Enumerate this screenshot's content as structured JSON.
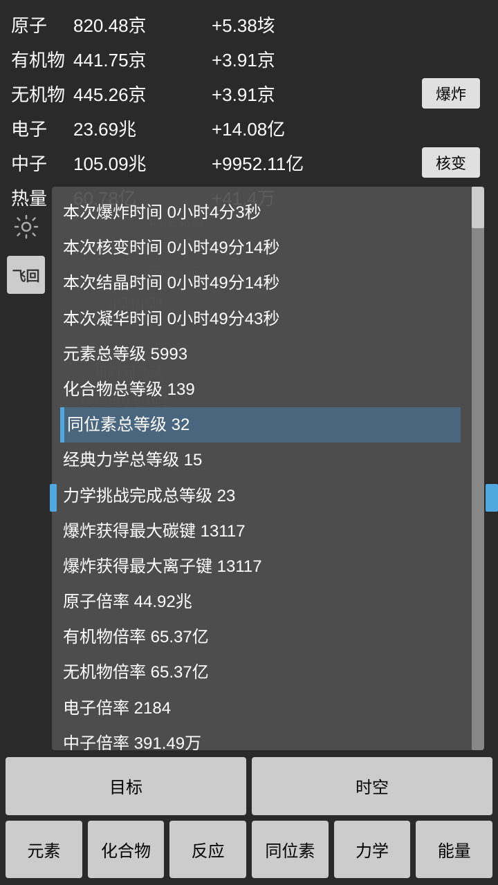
{
  "stats": [
    {
      "name": "原子",
      "value": "820.48京",
      "delta": "+5.38垓",
      "button": null
    },
    {
      "name": "有机物",
      "value": "441.75京",
      "delta": "+3.91京",
      "button": null
    },
    {
      "name": "无机物",
      "value": "445.26京",
      "delta": "+3.91京",
      "button": "爆炸"
    },
    {
      "name": "电子",
      "value": "23.69兆",
      "delta": "+14.08亿",
      "button": null
    },
    {
      "name": "中子",
      "value": "105.09兆",
      "delta": "+9952.11亿",
      "button": "核变"
    },
    {
      "name": "热量",
      "value": "60.78亿",
      "delta": "+41.4万",
      "button": null
    }
  ],
  "overlay_items": [
    {
      "text": "本次爆炸时间 0小时4分3秒",
      "highlighted": false
    },
    {
      "text": "本次核变时间 0小时49分14秒",
      "highlighted": false
    },
    {
      "text": "本次结晶时间 0小时49分14秒",
      "highlighted": false
    },
    {
      "text": "本次凝华时间 0小时49分43秒",
      "highlighted": false
    },
    {
      "text": "元素总等级 5993",
      "highlighted": false
    },
    {
      "text": "化合物总等级 139",
      "highlighted": false
    },
    {
      "text": "同位素总等级 32",
      "highlighted": true
    },
    {
      "text": "经典力学总等级 15",
      "highlighted": false
    },
    {
      "text": "力学挑战完成总等级 23",
      "highlighted": false
    },
    {
      "text": "爆炸获得最大碳键 13117",
      "highlighted": false
    },
    {
      "text": "爆炸获得最大离子键 13117",
      "highlighted": false
    },
    {
      "text": "原子倍率 44.92兆",
      "highlighted": false
    },
    {
      "text": "有机物倍率 65.37亿",
      "highlighted": false
    },
    {
      "text": "无机物倍率 65.37亿",
      "highlighted": false
    },
    {
      "text": "电子倍率 2184",
      "highlighted": false
    },
    {
      "text": "中子倍率 391.49万",
      "highlighted": false
    }
  ],
  "bg_text_lines": [
    "时空能量",
    "离线时间等量的超时空能量",
    "上限24小时",
    "小时小时",
    "机时间飞跃",
    "线绕进0.5小时",
    "支持自动重置"
  ],
  "nav": {
    "row1": [
      "目标",
      "时空"
    ],
    "row2": [
      "元素",
      "化合物",
      "反应",
      "同位素",
      "力学",
      "能量"
    ]
  },
  "left_btn_text": "飞\n回"
}
